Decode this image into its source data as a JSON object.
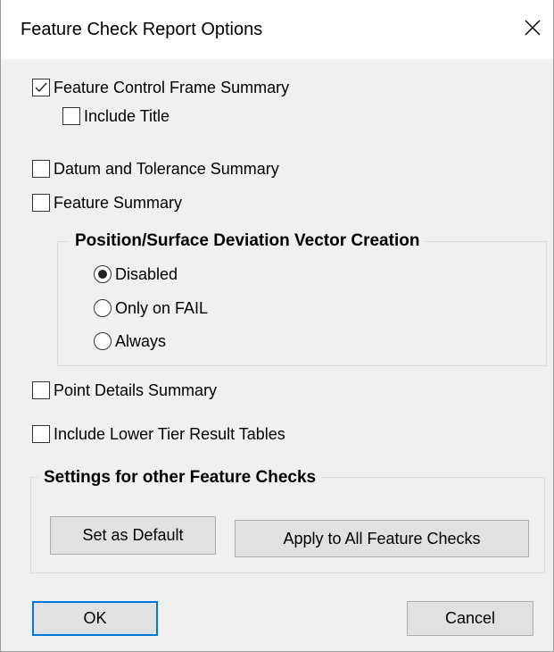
{
  "dialog": {
    "title": "Feature Check Report Options",
    "close_icon": "close-icon"
  },
  "options": {
    "feature_control_frame_summary": {
      "label": "Feature Control Frame Summary",
      "checked": true
    },
    "include_title": {
      "label": "Include Title",
      "checked": false
    },
    "datum_tolerance_summary": {
      "label": "Datum and Tolerance Summary",
      "checked": false
    },
    "feature_summary": {
      "label": "Feature Summary",
      "checked": false
    },
    "point_details_summary": {
      "label": "Point Details Summary",
      "checked": false
    },
    "lower_tier_tables": {
      "label": "Include Lower Tier Result Tables",
      "checked": false
    }
  },
  "vector_group": {
    "title": "Position/Surface Deviation Vector Creation",
    "options": [
      {
        "label": "Disabled",
        "selected": true
      },
      {
        "label": "Only on FAIL",
        "selected": false
      },
      {
        "label": "Always",
        "selected": false
      }
    ]
  },
  "settings_group": {
    "title": "Settings for other Feature Checks",
    "set_default_label": "Set as Default",
    "apply_all_label": "Apply to All Feature Checks"
  },
  "footer": {
    "ok_label": "OK",
    "cancel_label": "Cancel"
  },
  "colors": {
    "dialog_bg": "#f0f0f0",
    "titlebar_bg": "#ffffff",
    "button_bg": "#e1e1e1",
    "default_button_border": "#0078d7"
  }
}
